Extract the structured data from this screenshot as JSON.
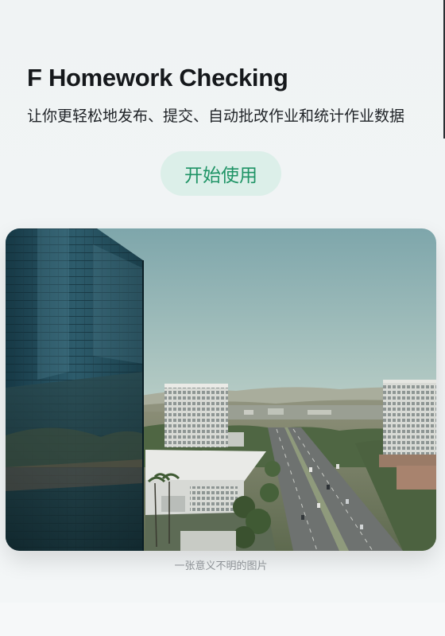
{
  "hero": {
    "title": "F Homework Checking",
    "subtitle": "让你更轻松地发布、提交、自动批改作业和统计作业数据",
    "cta_label": "开始使用"
  },
  "figure": {
    "caption": "一张意义不明的图片",
    "image_description": "aerial-city-office-buildings-highway-photo"
  },
  "colors": {
    "background": "#f1f4f5",
    "cta_background": "#dcefe9",
    "cta_text": "#1f9466",
    "caption_text": "#8d9296"
  }
}
